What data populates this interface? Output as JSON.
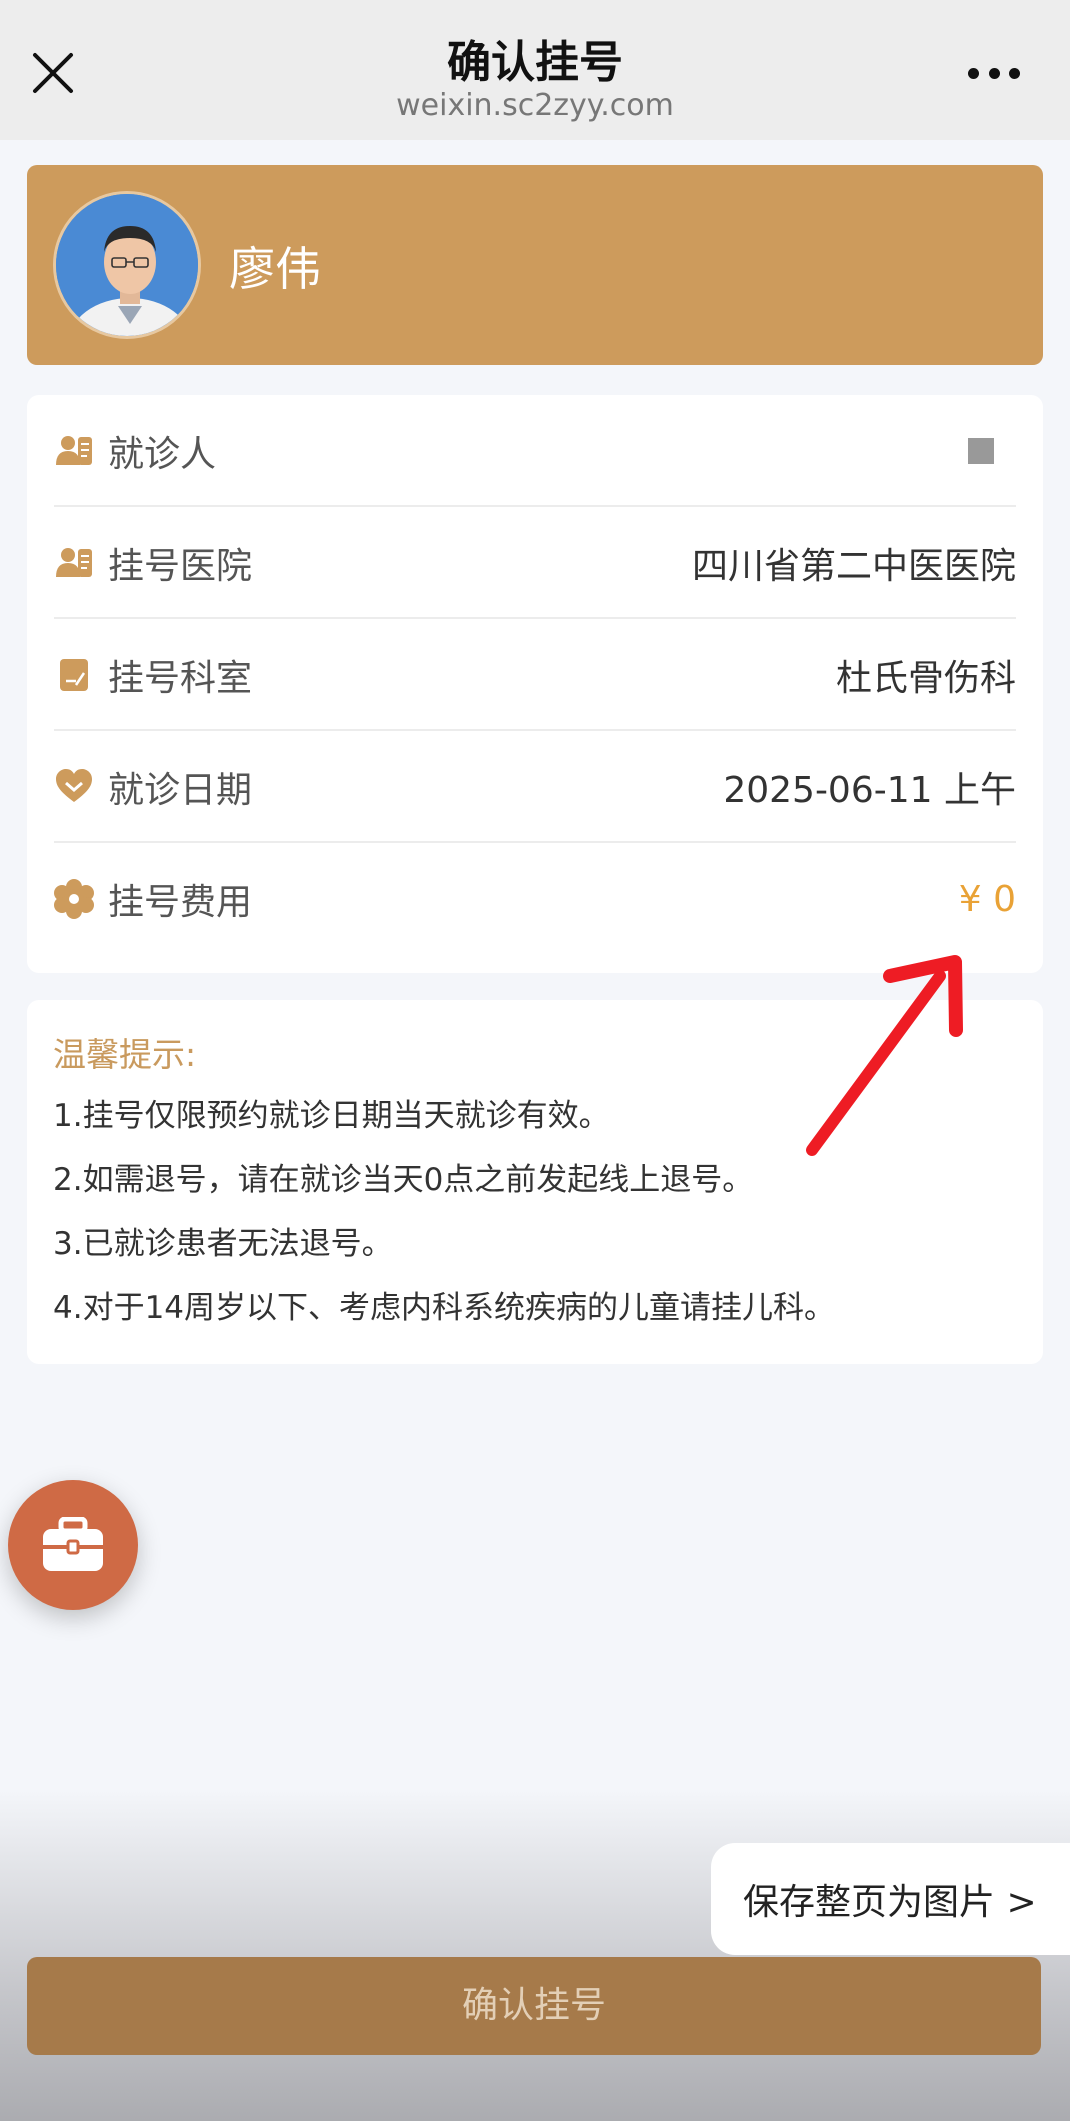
{
  "navbar": {
    "title": "确认挂号",
    "url": "weixin.sc2zyy.com"
  },
  "doctor": {
    "name": "廖伟"
  },
  "info": {
    "rows": [
      {
        "icon": "patient-card-icon",
        "label": "就诊人",
        "value": ""
      },
      {
        "icon": "patient-card-icon",
        "label": "挂号医院",
        "value": "四川省第二中医医院"
      },
      {
        "icon": "document-edit-icon",
        "label": "挂号科室",
        "value": "杜氏骨伤科"
      },
      {
        "icon": "heart-icon",
        "label": "就诊日期",
        "value": "2025-06-11 上午"
      },
      {
        "icon": "flower-gear-icon",
        "label": "挂号费用",
        "value": "¥ 0"
      }
    ]
  },
  "tips": {
    "title": "温馨提示:",
    "items": [
      "1.挂号仅限预约就诊日期当天就诊有效。",
      "2.如需退号，请在就诊当天0点之前发起线上退号。",
      "3.已就诊患者无法退号。",
      "4.对于14周岁以下、考虑内科系统疾病的儿童请挂儿科。"
    ]
  },
  "save_page_label": "保存整页为图片 >",
  "confirm_button_label": "确认挂号",
  "colors": {
    "brand": "#cd9b5c",
    "fee": "#e9a236",
    "confirm_button": "#a67a4a",
    "fab": "#cf6a45",
    "annotation_arrow": "#ee1c24"
  }
}
